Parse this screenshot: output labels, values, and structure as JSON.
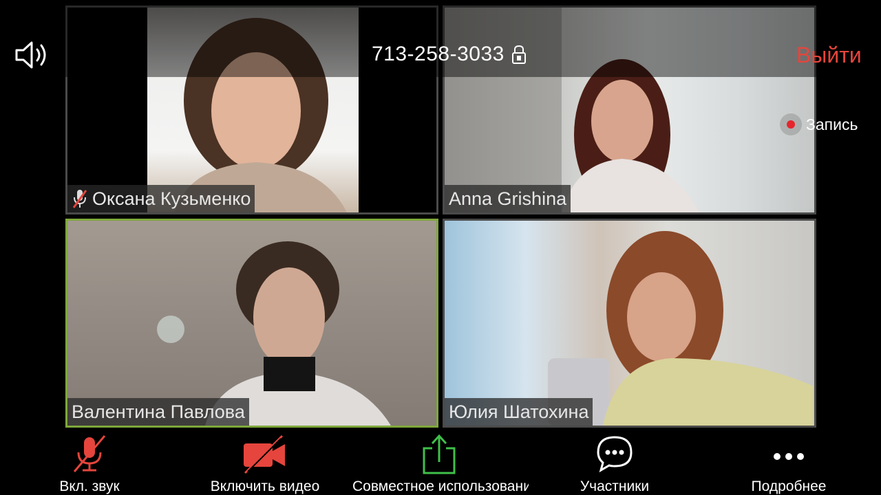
{
  "top_bar": {
    "meeting_id": "713-258-3033",
    "leave_label": "Выйти"
  },
  "recording": {
    "label": "Запись"
  },
  "participants": [
    {
      "name": "Оксана Кузьменко",
      "muted": true,
      "active_speaker": false
    },
    {
      "name": "Anna Grishina",
      "muted": false,
      "active_speaker": false
    },
    {
      "name": "Валентина Павлова",
      "muted": false,
      "active_speaker": true
    },
    {
      "name": "Юлия Шатохина",
      "muted": false,
      "active_speaker": false
    }
  ],
  "toolbar": {
    "audio_label": "Вкл. звук",
    "video_label": "Включить видео",
    "share_label": "Совместное использование",
    "participants_label": "Участники",
    "more_label": "Подробнее"
  },
  "colors": {
    "leave": "#e5453c",
    "recording_dot": "#e5262c",
    "muted_icon": "#e5453c",
    "share_icon": "#3fbf4a",
    "active_speaker_border": "#7fa83a"
  },
  "icons": [
    "speaker-icon",
    "lock-icon",
    "record-dot-icon",
    "mic-muted-icon",
    "video-off-icon",
    "share-screen-icon",
    "chat-bubble-icon",
    "more-dots-icon"
  ]
}
